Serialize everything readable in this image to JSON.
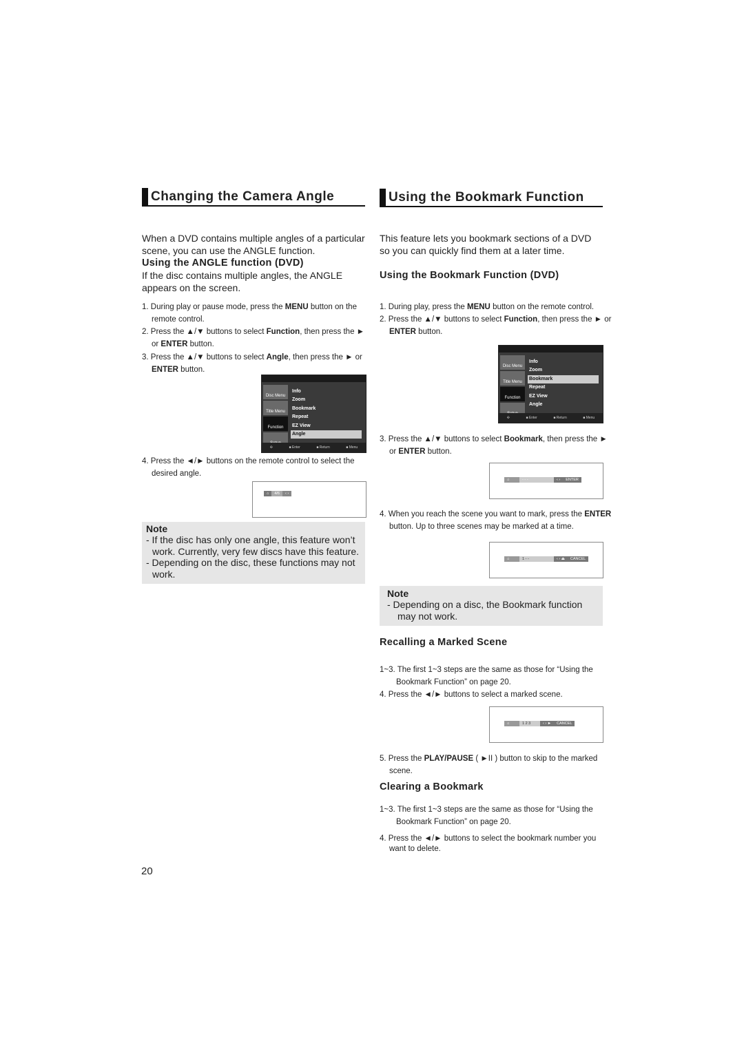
{
  "left": {
    "title": "Changing the Camera Angle",
    "intro": "When a DVD contains multiple angles of a particular scene, you can use the ANGLE function.",
    "subheading": "Using the ANGLE function (DVD)",
    "subintro": "If the disc contains multiple angles, the ANGLE appears on the screen.",
    "steps": [
      "1. During play or pause mode, press the <b>MENU</b> button on the remote control.",
      "2. Press the ▲/▼ buttons to select <b>Function</b>, then press the ► or <b>ENTER</b> button.",
      "3. Press the ▲/▼ buttons to select <b>Angle</b>, then press the ► or <b>ENTER</b> button.",
      "4. Press the ◄/► buttons on the remote control to select the desired angle."
    ],
    "menu": {
      "side": [
        "Disc Menu",
        "Title Menu",
        "Function",
        "Setup"
      ],
      "items": [
        "Info",
        "Zoom",
        "Bookmark",
        "Repeat",
        "EZ View",
        "Angle"
      ],
      "selected": "Angle",
      "bottom": [
        "Enter",
        "Return",
        "Menu"
      ]
    },
    "angle_display": "4/6",
    "note": {
      "title": "Note",
      "lines": [
        "- If the disc has only one angle, this feature won’t work. Currently, very few discs have this feature.",
        "- Depending on the disc, these functions may not work."
      ]
    },
    "page_number": "20"
  },
  "right": {
    "title": "Using the Bookmark Function",
    "intro": "This feature lets you bookmark sections of a DVD so you can quickly find them at a later time.",
    "subheading": "Using the Bookmark Function (DVD)",
    "steps": [
      "1. During play, press the <b>MENU</b> button on the remote control.",
      "2. Press the ▲/▼ buttons to select <b>Function</b>, then press the ► or <b>ENTER</b> button."
    ],
    "menu": {
      "side": [
        "Disc Menu",
        "Title Menu",
        "Function",
        "Setup"
      ],
      "items": [
        "Info",
        "Zoom",
        "Bookmark",
        "Repeat",
        "EZ View",
        "Angle"
      ],
      "selected": "Bookmark",
      "bottom": [
        "Enter",
        "Return",
        "Menu"
      ]
    },
    "step3": "3. Press the ▲/▼ buttons to select <b>Bookmark</b>, then press the ► or <b>ENTER</b> button.",
    "bar1": {
      "marks": "-  -  -",
      "button": "ENTER"
    },
    "step4": "4. When you reach the scene you want to mark, press the <b>ENTER</b> button. Up to three scenes may be marked at a time.",
    "bar2": {
      "marks": "1  -  -",
      "button": "CANCEL"
    },
    "note": {
      "title": "Note",
      "lines": [
        "- Depending on a disc, the Bookmark function may not work."
      ]
    },
    "recall": {
      "heading": "Recalling a Marked Scene",
      "steps": [
        "1~3. The first 1~3 steps are the same as those for “Using the Bookmark Function” on page 20.",
        "4.  Press the ◄/► buttons to select a marked scene."
      ],
      "bar": {
        "marks": "1  2  3",
        "button": "CANCEL"
      },
      "step5": "5. Press the <b>PLAY/PAUSE</b> ( ►II ) button to skip to the marked scene."
    },
    "clear": {
      "heading": "Clearing a Bookmark",
      "steps": [
        "1~3. The first 1~3 steps are the same as those for  “Using the Bookmark Function” on page 20.",
        "4. Press the ◄/► buttons to select the bookmark number you want to delete."
      ]
    }
  }
}
